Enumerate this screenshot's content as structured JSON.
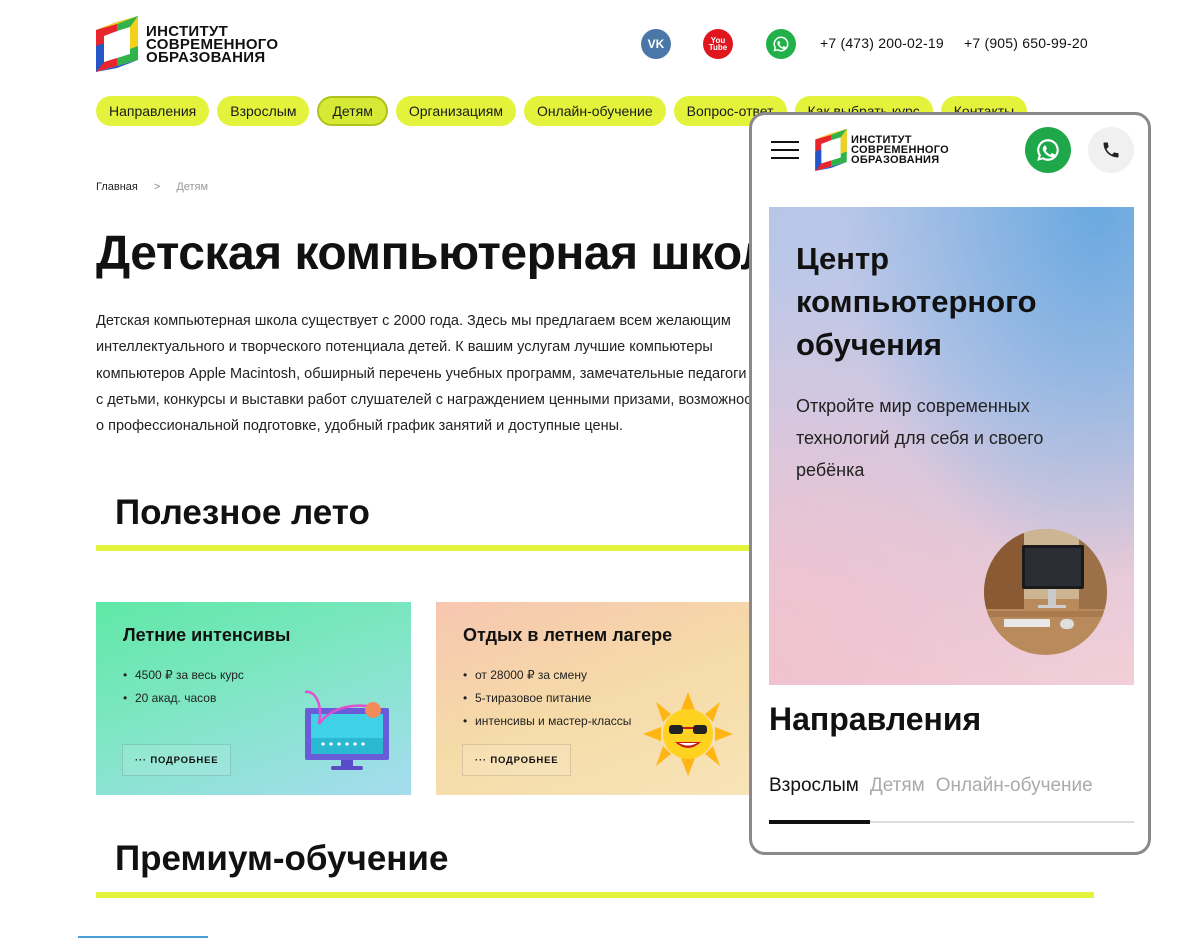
{
  "brand": {
    "logo_lines": [
      "ИНСТИТУТ",
      "СОВРЕМЕННОГО",
      "ОБРАЗОВАНИЯ"
    ],
    "colors": {
      "accent_yellow": "#e3f33b",
      "logo_red": "#e8242c",
      "logo_blue": "#2456c8",
      "logo_green": "#2fb34a",
      "logo_yellow": "#f2d01c"
    }
  },
  "header": {
    "socials": [
      {
        "icon": "vk-icon",
        "label": "VK"
      },
      {
        "icon": "youtube-icon",
        "label": "You Tube"
      },
      {
        "icon": "whatsapp-icon",
        "label": ""
      }
    ],
    "phones": [
      "+7 (473) 200-02-19",
      "+7 (905) 650-99-20"
    ]
  },
  "nav": {
    "items": [
      {
        "label": "Направления",
        "active": false
      },
      {
        "label": "Взрослым",
        "active": false
      },
      {
        "label": "Детям",
        "active": true
      },
      {
        "label": "Организациям",
        "active": false
      },
      {
        "label": "Онлайн-обучение",
        "active": false
      },
      {
        "label": "Вопрос-ответ",
        "active": false
      },
      {
        "label": "Как выбрать курс",
        "active": false
      },
      {
        "label": "Контакты",
        "active": false
      }
    ]
  },
  "breadcrumb": {
    "home": "Главная",
    "separator": ">",
    "current": "Детям"
  },
  "page": {
    "title": "Детская компьютерная школа",
    "intro_lines": [
      "Детская компьютерная школа существует с 2000 года. Здесь мы предлагаем всем желающим",
      "интеллектуального и творческого потенциала детей. К вашим услугам лучшие компьютеры",
      "компьютеров Apple Macintosh, обширный перечень учебных программ, замечательные педагоги",
      "с детьми, конкурсы и выставки работ слушателей с награждением ценными призами, возможность",
      "о профессиональной подготовке, удобный график занятий и доступные цены."
    ]
  },
  "sections": {
    "summer": {
      "title": "Полезное лето"
    },
    "premium": {
      "title": "Премиум-обучение"
    }
  },
  "cards": [
    {
      "title": "Летние интенсивы",
      "bullets": [
        "4500 ₽ за весь курс",
        "20 акад. часов"
      ],
      "button": "··· ПОДРОБНЕЕ",
      "art_icon": "monitor-illustration-icon"
    },
    {
      "title": "Отдых в летнем лагере",
      "bullets": [
        "от 28000 ₽ за смену",
        "5-тиразовое питание",
        "интенсивы и мастер-классы"
      ],
      "button": "··· ПОДРОБНЕЕ",
      "art_icon": "sun-illustration-icon"
    }
  ],
  "mobile": {
    "hero": {
      "title_lines": [
        "Центр",
        "компьютерного",
        "обучения"
      ],
      "subtitle_lines": [
        "Откройте мир современных",
        "технологий для себя и своего",
        "ребёнка"
      ]
    },
    "section_title": "Направления",
    "tabs": [
      {
        "label": "Взрослым",
        "active": true
      },
      {
        "label": "Детям",
        "active": false
      },
      {
        "label": "Онлайн-обучение",
        "active": false
      }
    ]
  }
}
